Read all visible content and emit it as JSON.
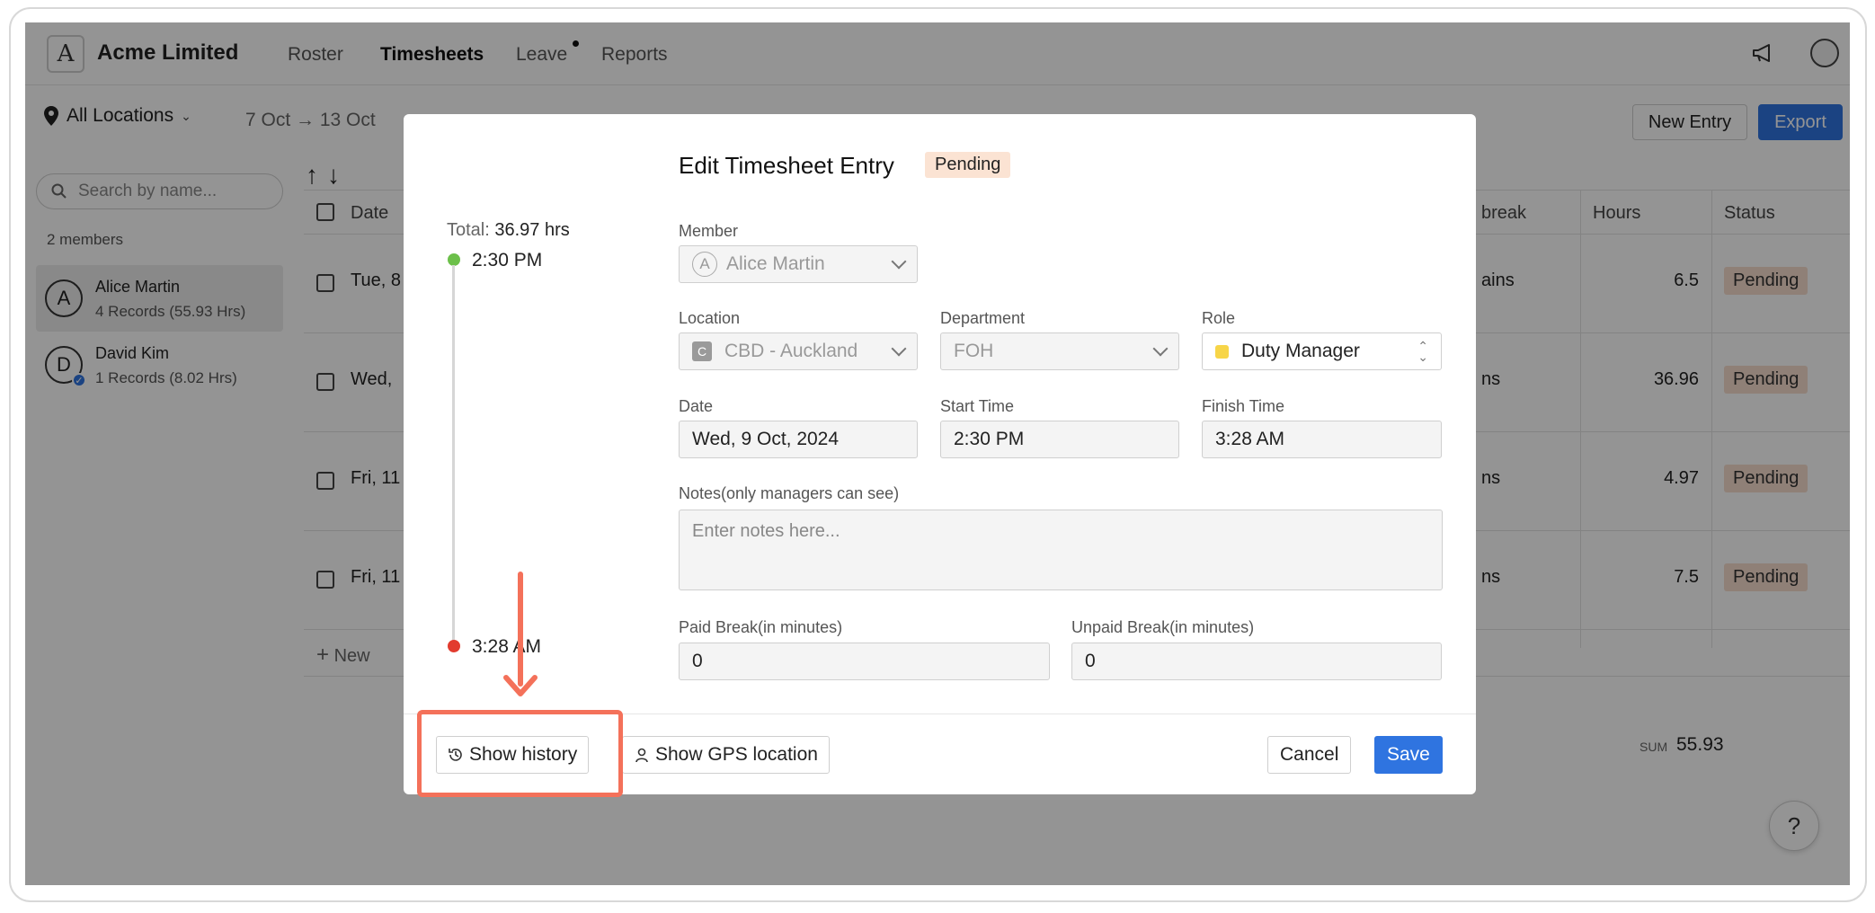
{
  "app": {
    "company": "Acme Limited",
    "logo_letter": "A",
    "nav": [
      "Roster",
      "Timesheets",
      "Leave",
      "Reports"
    ]
  },
  "toolbar": {
    "location": "All Locations",
    "date_range": "7 Oct → 13 Oct",
    "new_entry": "New Entry",
    "export": "Export"
  },
  "sidebar": {
    "search_placeholder": "Search by name...",
    "members_count": "2 members",
    "members": [
      {
        "initial": "A",
        "name": "Alice Martin",
        "sub": "4 Records (55.93 Hrs)"
      },
      {
        "initial": "D",
        "name": "David Kim",
        "sub": "1 Records (8.02 Hrs)"
      }
    ]
  },
  "table": {
    "headers": {
      "date": "Date",
      "break": "break",
      "hours": "Hours",
      "status": "Status"
    },
    "rows": [
      {
        "date": "Tue, 8",
        "break": "ains",
        "hours": "6.5",
        "status": "Pending"
      },
      {
        "date": "Wed,",
        "break": "ns",
        "hours": "36.96",
        "status": "Pending"
      },
      {
        "date": "Fri, 11",
        "break": "ns",
        "hours": "4.97",
        "status": "Pending"
      },
      {
        "date": "Fri, 11",
        "break": "ns",
        "hours": "7.5",
        "status": "Pending"
      }
    ],
    "new_label": "New",
    "sum_label": "SUM",
    "sum_value": "55.93"
  },
  "modal": {
    "title": "Edit Timesheet Entry",
    "status": "Pending",
    "total_label": "Total:",
    "total_value": "36.97 hrs",
    "start_time_tl": "2:30 PM",
    "end_time_tl": "3:28 AM",
    "member_label": "Member",
    "member_value": "Alice Martin",
    "member_initial": "A",
    "location_label": "Location",
    "location_value": "CBD - Auckland",
    "location_initial": "C",
    "department_label": "Department",
    "department_value": "FOH",
    "role_label": "Role",
    "role_value": "Duty Manager",
    "date_label": "Date",
    "date_value": "Wed, 9 Oct, 2024",
    "start_label": "Start Time",
    "start_value": "2:30 PM",
    "finish_label": "Finish Time",
    "finish_value": "3:28 AM",
    "notes_label": "Notes(only managers can see)",
    "notes_placeholder": "Enter notes here...",
    "paid_break_label": "Paid Break(in minutes)",
    "paid_break_value": "0",
    "unpaid_break_label": "Unpaid Break(in minutes)",
    "unpaid_break_value": "0",
    "show_history": "Show history",
    "show_gps": "Show GPS location",
    "cancel": "Cancel",
    "save": "Save"
  },
  "help_label": "?",
  "colors": {
    "accent": "#2f74e0",
    "annotation": "#f4715a",
    "pending_bg": "#fbe3d3",
    "start_dot": "#6cc04a",
    "end_dot": "#e23b2e",
    "role_swatch": "#f7d548"
  }
}
